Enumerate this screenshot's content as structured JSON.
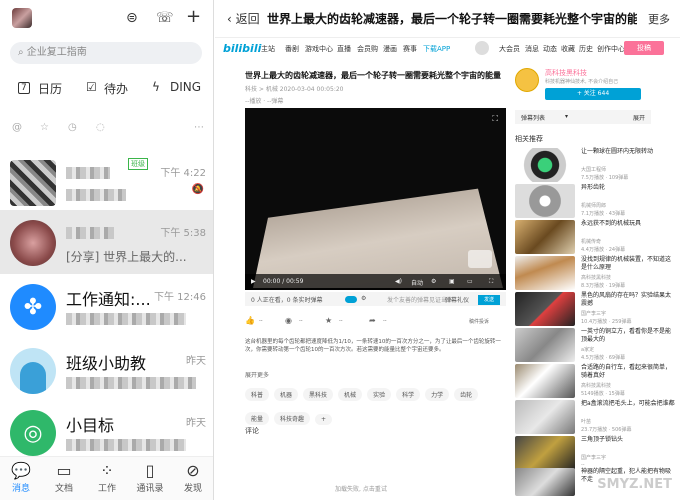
{
  "left": {
    "search_placeholder": "企业复工指南",
    "quick": {
      "calendar_day": "7",
      "calendar": "日历",
      "todo": "待办",
      "ding": "DING"
    },
    "chats": [
      {
        "name": "",
        "time": "下午 4:22",
        "badge": "班级",
        "preview": ""
      },
      {
        "name": "",
        "time": "下午 5:38",
        "preview": "[分享] 世界上最大的..."
      },
      {
        "name": "工作通知:...",
        "time": "下午 12:46",
        "preview": ""
      },
      {
        "name": "班级小助教",
        "time": "昨天",
        "preview": ""
      },
      {
        "name": "小目标",
        "time": "昨天",
        "preview": ""
      }
    ],
    "tabs": [
      "消息",
      "文档",
      "工作",
      "通讯录",
      "发现"
    ]
  },
  "right": {
    "back": "返回",
    "title": "世界上最大的齿轮减速器，最后一个轮子转一圈需要耗光整个宇宙的能...",
    "more": "更多",
    "logo": "bilibili",
    "nav": [
      "主站",
      "番剧",
      "游戏中心",
      "直播",
      "会员购",
      "漫画",
      "赛事",
      "下载APP"
    ],
    "nav_right": [
      "大会员",
      "消息",
      "动态",
      "收藏",
      "历史",
      "创作中心"
    ],
    "upload": "投稿",
    "video": {
      "title": "世界上最大的齿轮减速器，最后一个轮子转一圈需要耗光整个宇宙的能量",
      "meta": "科技 > 机械   2020-03-04 00:05:20",
      "meta2": "--播放 · --弹幕",
      "time": "00:00 / 00:59",
      "quality": "自动",
      "viewers": "0 人正在看，0 条实时弹幕",
      "danmu_placeholder": "发个友善的弹幕见证当下",
      "etiquette": "弹幕礼仪",
      "send": "发送",
      "actions": [
        "--",
        "--",
        "--",
        "--"
      ],
      "report": "稿件投诉",
      "desc": "这台机器里的每个齿轮都把速度降低为1/10，一条转速10的一百次方分之一，为了让最后一个齿轮旋转一次，你需要转动第一个齿轮10的一百次方次。若这需要的能量比整个宇宙还要多。",
      "expand": "展开更多",
      "tags": [
        "科普",
        "机器",
        "黑科技",
        "机械",
        "实验",
        "科学",
        "力学",
        "齿轮",
        "能量",
        "科技奇趣"
      ],
      "comment": "评论",
      "loading": "加载失败, 点击重试"
    },
    "uploader": {
      "name": "高科技黑科技",
      "sub": "科技机器神仙技术, 不会介绍自己",
      "follow": "+ 关注 644"
    },
    "danmu_list": {
      "label": "弹幕列表",
      "expand": "展开"
    },
    "related_header": "相关推荐",
    "related": [
      {
        "title": "让一颗球在圆环内无限转动",
        "up": "大国工程师",
        "stats": "7.5万播放 · 109弹幕"
      },
      {
        "title": "异形齿轮",
        "up": "机械师周郎",
        "stats": "7.1万播放 · 43弹幕"
      },
      {
        "title": "永远获不到的机械玩具",
        "up": "机械传奇",
        "stats": "4.4万播放 · 24弹幕"
      },
      {
        "title": "没找到规律的机械装置，不知道这是什么原理",
        "up": "高科技黑科技",
        "stats": "8.3万播放 · 19弹幕"
      },
      {
        "title": "黑色的风扇的存在吗？实验结果太震撼",
        "up": "国产李三宇",
        "stats": "10.4万播放 · 259弹幕"
      },
      {
        "title": "一英寸的铜立方，看看你是不是能顶最大的",
        "up": "a家定",
        "stats": "4.5万播放 · 69弹幕"
      },
      {
        "title": "合适路的自行车，看起来很简单，骑着真好",
        "up": "高科技黑科技",
        "stats": "5149播放 · 15弹幕"
      },
      {
        "title": "把a盒滚流把毛头上，可能会把谁都",
        "up": "叶苗",
        "stats": "23.7万播放 · 506弹幕"
      },
      {
        "title": "三角顶子锁钻头",
        "up": "国产李三宇",
        "stats": "--"
      },
      {
        "title": "神器的隔空起重，犯人能把有物吸不走",
        "up": "",
        "stats": ""
      }
    ],
    "watermark": "SMYZ.NET"
  }
}
